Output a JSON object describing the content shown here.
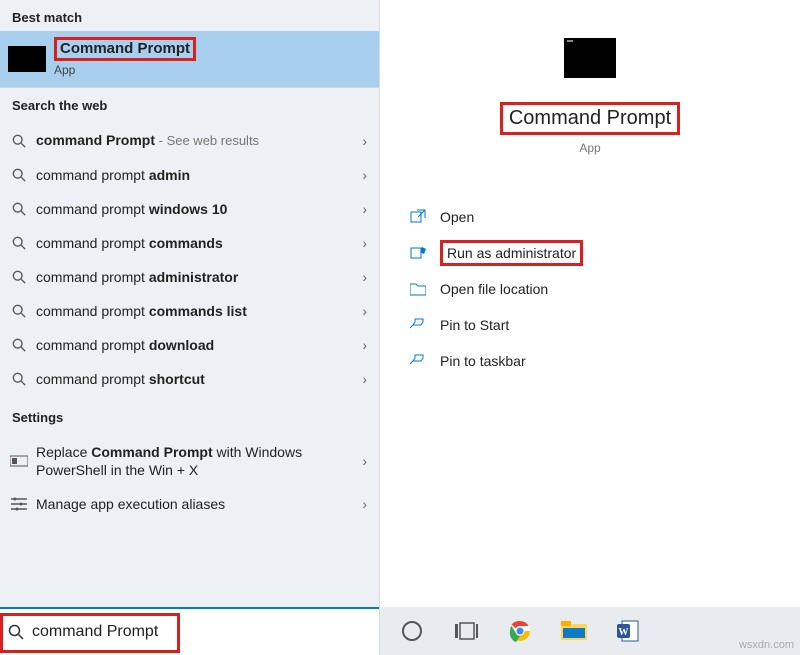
{
  "left": {
    "best_match_header": "Best match",
    "best_match": {
      "title": "Command Prompt",
      "subtitle": "App"
    },
    "search_web_header": "Search the web",
    "web_results": [
      {
        "prefix": "",
        "bold": "command Prompt",
        "suffix": "",
        "hint": " - See web results"
      },
      {
        "prefix": "command prompt ",
        "bold": "admin",
        "suffix": "",
        "hint": ""
      },
      {
        "prefix": "command prompt ",
        "bold": "windows 10",
        "suffix": "",
        "hint": ""
      },
      {
        "prefix": "command prompt ",
        "bold": "commands",
        "suffix": "",
        "hint": ""
      },
      {
        "prefix": "command prompt ",
        "bold": "administrator",
        "suffix": "",
        "hint": ""
      },
      {
        "prefix": "command prompt ",
        "bold": "commands list",
        "suffix": "",
        "hint": ""
      },
      {
        "prefix": "command prompt ",
        "bold": "download",
        "suffix": "",
        "hint": ""
      },
      {
        "prefix": "command prompt ",
        "bold": "shortcut",
        "suffix": "",
        "hint": ""
      }
    ],
    "settings_header": "Settings",
    "settings": [
      {
        "label_pre": "Replace ",
        "label_bold": "Command Prompt",
        "label_post": " with Windows PowerShell in the Win + X"
      },
      {
        "label_pre": "Manage app execution aliases",
        "label_bold": "",
        "label_post": ""
      }
    ],
    "search_value": "command Prompt"
  },
  "right": {
    "title": "Command Prompt",
    "subtitle": "App",
    "actions": [
      {
        "icon": "open",
        "label": "Open"
      },
      {
        "icon": "admin",
        "label": "Run as administrator",
        "highlight": true
      },
      {
        "icon": "folder",
        "label": "Open file location"
      },
      {
        "icon": "pin",
        "label": "Pin to Start"
      },
      {
        "icon": "pin",
        "label": "Pin to taskbar"
      }
    ]
  },
  "watermark": "wsxdn.com"
}
